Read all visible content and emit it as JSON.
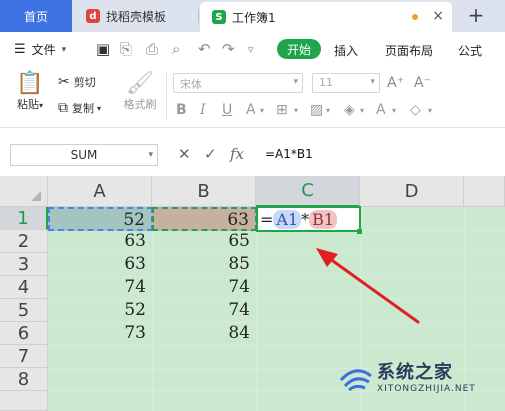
{
  "tabs": {
    "home": "首页",
    "template": "找稻壳模板",
    "workbook": "工作簿1",
    "add": "+",
    "close": "×"
  },
  "menu": {
    "file": "文件",
    "start": "开始",
    "insert": "插入",
    "page_layout": "页面布局",
    "formula": "公式"
  },
  "ribbon": {
    "paste": "粘贴",
    "cut": "剪切",
    "copy": "复制",
    "format_painter": "格式刷",
    "font_name": "宋体",
    "font_size": "11"
  },
  "formula_bar": {
    "name_box": "SUM",
    "cancel": "✕",
    "confirm": "✓",
    "fx": "fx",
    "formula": "=A1*B1"
  },
  "sheet": {
    "columns": [
      "A",
      "B",
      "C",
      "D"
    ],
    "rows": [
      "1",
      "2",
      "3",
      "4",
      "5",
      "6",
      "7",
      "8"
    ],
    "col_a": [
      "52",
      "63",
      "63",
      "74",
      "52",
      "73"
    ],
    "col_b": [
      "63",
      "65",
      "85",
      "74",
      "74",
      "84"
    ],
    "c1_eq": "=",
    "c1_ref_a": "A1",
    "c1_op": "*",
    "c1_ref_b": "B1"
  },
  "colors": {
    "accent_green": "#1fa64b",
    "tab_blue": "#3f73e4",
    "sheet_fill": "#cbe9cf",
    "arrow_red": "#e02020"
  },
  "watermark": {
    "title": "系统之家",
    "url": "XITONGZHIJIA.NET"
  }
}
